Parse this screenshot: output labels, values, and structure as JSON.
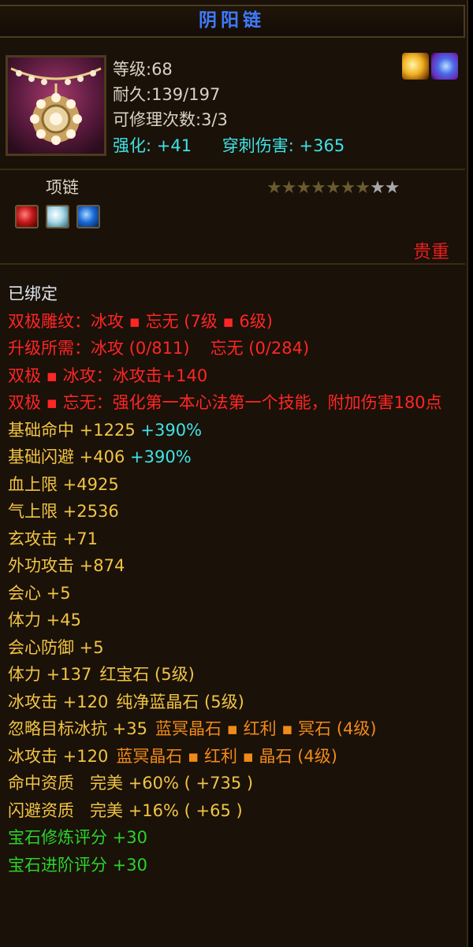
{
  "title": "阴阳链",
  "item": {
    "level": "等级:68",
    "durability": "耐久:139/197",
    "repairs": "可修理次数:3/3",
    "strengthen_label": "强化:",
    "strengthen_value": "+41",
    "pierce_label": "穿刺伤害:",
    "pierce_value": "+365",
    "type": "项链",
    "stars_filled": 7,
    "stars_total": 9,
    "rarity": "贵重",
    "socket_icons": [
      "red-gem-icon",
      "white-gem-icon",
      "blue-gem-icon"
    ],
    "badge_icons": [
      "gold-fire-badge-icon",
      "purple-swirl-badge-icon"
    ]
  },
  "colors": {
    "title": "#3e7bff",
    "cyan": "#3ee3e6",
    "red": "#ff2626",
    "gold": "#f0c445",
    "orange": "#f08a1a",
    "green": "#29d42c"
  },
  "lines": {
    "bound": "已绑定",
    "dual_carve": "双极雕纹：冰攻 ▪ 忘无 (7级 ▪ 6级)",
    "upgrade_req_a": "升级所需：冰攻 (0/811)",
    "upgrade_req_b": "忘无 (0/284)",
    "dual_ice": "双极 ▪ 冰攻：冰攻击+140",
    "dual_wang": "双极 ▪ 忘无：强化第一本心法第一个技能，附加伤害180点",
    "acc_label": "基础命中 +1225",
    "acc_pct": "+390%",
    "eva_label": "基础闪避 +406",
    "eva_pct": "+390%",
    "hp": "血上限 +4925",
    "qi": "气上限 +2536",
    "xuan": "玄攻击 +71",
    "outer": "外功攻击 +874",
    "crit": "会心 +5",
    "stamina": "体力 +45",
    "crit_def": "会心防御 +5",
    "gem1_stat": "体力 +137",
    "gem1_name": "红宝石 (5级)",
    "gem2_stat": "冰攻击 +120",
    "gem2_name": "纯净蓝晶石 (5级)",
    "gem3_stat": "忽略目标冰抗 +35",
    "gem3_name": "蓝冥晶石 ▪ 红利 ▪ 冥石 (4级)",
    "gem4_stat": "冰攻击 +120",
    "gem4_name": "蓝冥晶石 ▪ 红利 ▪ 晶石 (4级)",
    "apt1": "命中资质   完美 +60% ( +735 )",
    "apt2": "闪避资质   完美 +16% ( +65 )",
    "score1": "宝石修炼评分 +30",
    "score2": "宝石进阶评分 +30"
  }
}
